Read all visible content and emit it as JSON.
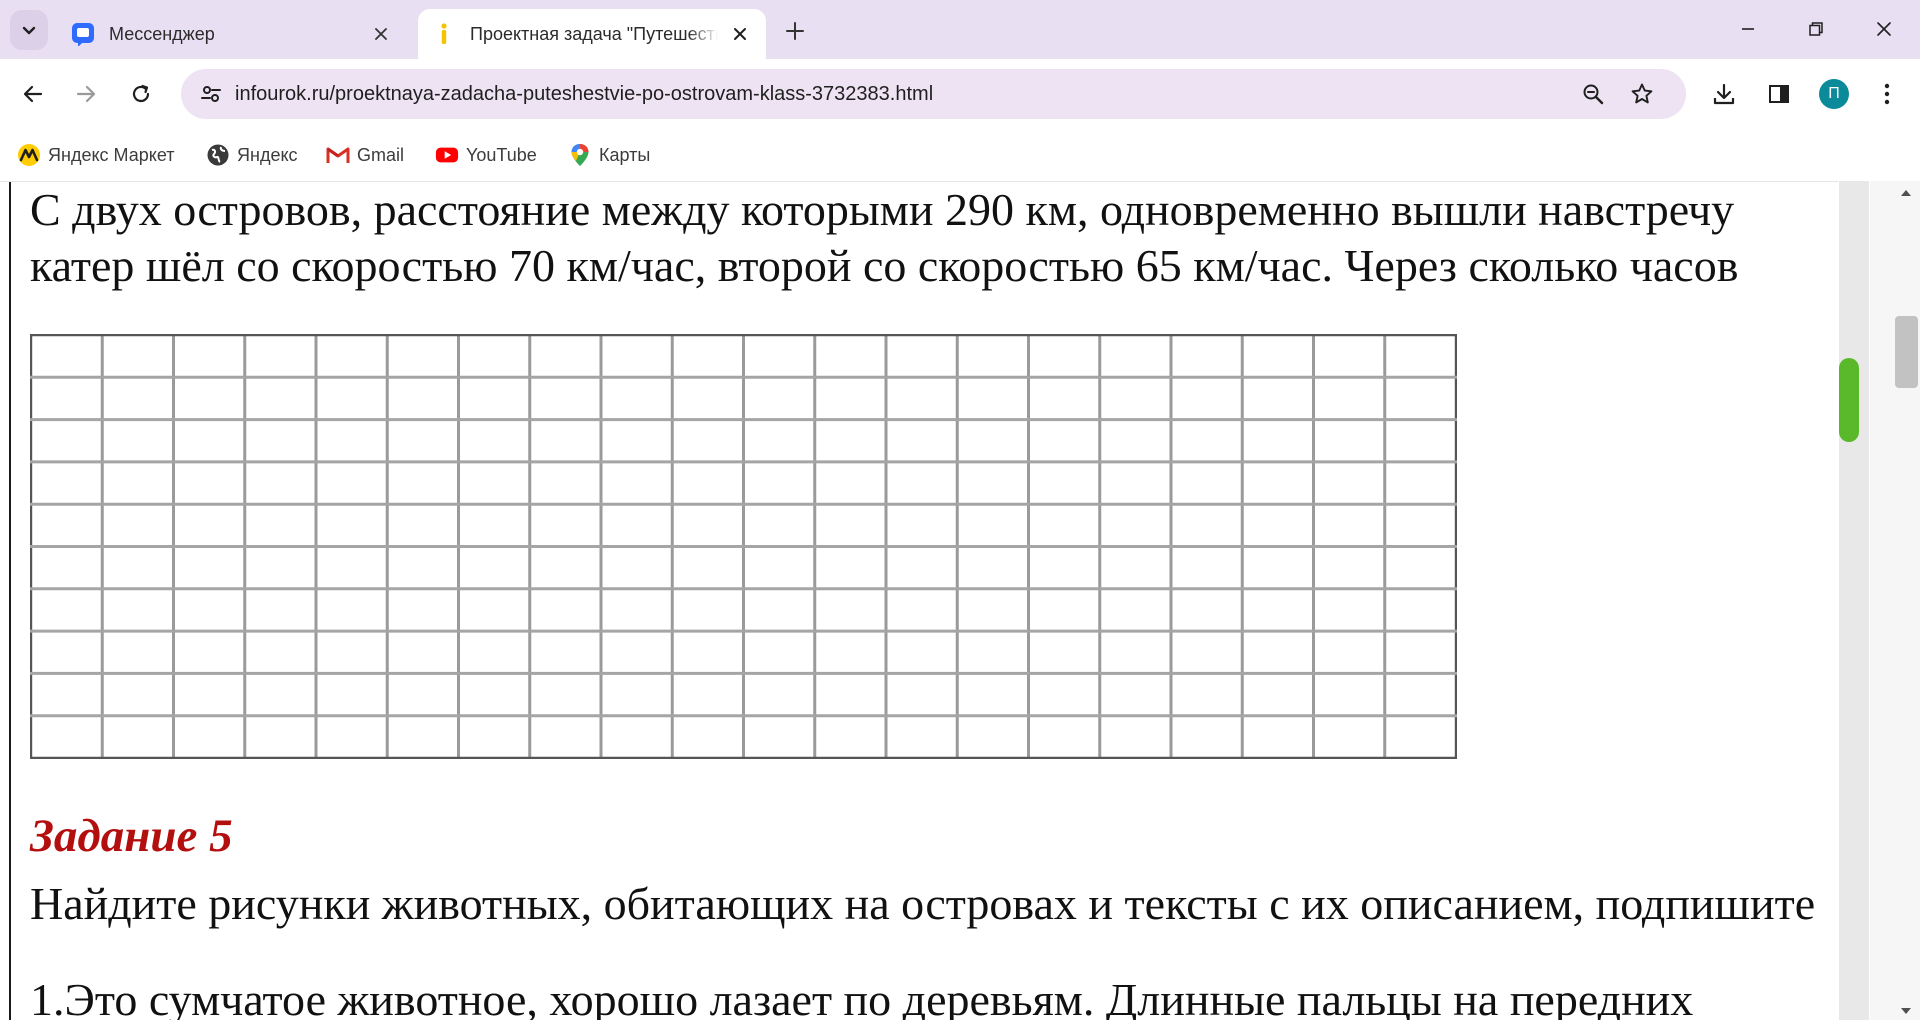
{
  "browser": {
    "tabs": [
      {
        "title": "Мессенджер",
        "favicon": "messenger-icon",
        "active": false
      },
      {
        "title": "Проектная задача \"Путешествие по островам\"",
        "favicon": "infourok-icon",
        "active": true
      }
    ],
    "address_bar": {
      "url": "infourok.ru/proektnaya-zadacha-puteshestvie-po-ostrovam-klass-3732383.html"
    },
    "profile_initial": "П",
    "bookmarks": [
      {
        "label": "Яндекс Маркет",
        "icon": "yandex-market-icon"
      },
      {
        "label": "Яндекс",
        "icon": "globe-icon"
      },
      {
        "label": "Gmail",
        "icon": "gmail-icon"
      },
      {
        "label": "YouTube",
        "icon": "youtube-icon"
      },
      {
        "label": "Карты",
        "icon": "maps-pin-icon"
      }
    ]
  },
  "document": {
    "problem_line_1": "С двух островов, расстояние между которыми 290 км, одновременно вышли навстречу",
    "problem_line_2": "катер шёл со скоростью 70 км/час, второй со скоростью 65 км/час. Через сколько часов",
    "task_heading": "Задание 5",
    "task_text": "Найдите рисунки животных, обитающих на островах и тексты с их описанием, подпишите",
    "item_1_text": "1.Это сумчатое животное, хорошо лазает по деревьям. Длинные пальцы на передних"
  },
  "colors": {
    "tabstrip": "#e9dff2",
    "omnibox": "#ede3f3",
    "heading_red": "#b30f0f",
    "scroll_thumb_green": "#59b92a",
    "avatar_teal": "#0b8a9a"
  }
}
